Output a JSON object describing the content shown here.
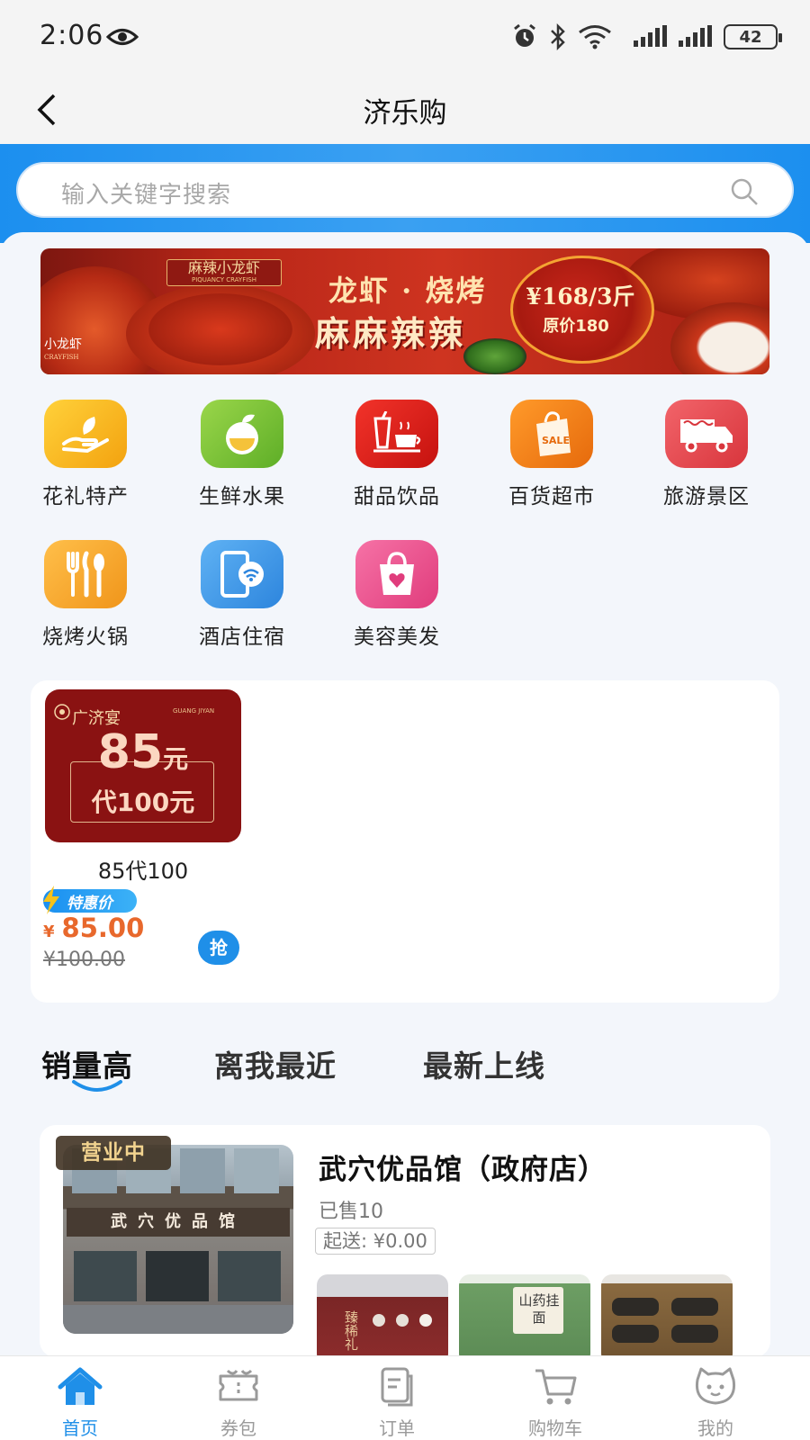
{
  "status_bar": {
    "time": "2:06",
    "battery": "42"
  },
  "nav": {
    "title": "济乐购"
  },
  "search": {
    "placeholder": "输入关键字搜索"
  },
  "banner": {
    "brand": "麻辣小龙虾",
    "brand_en": "PIQUANCY CRAYFISH",
    "line1": "龙虾 · 烧烤",
    "line2": "麻麻辣辣",
    "price": "¥168/3斤",
    "original_price": "原价180",
    "corner_tag": "小龙虾",
    "corner_tag_en": "CRAYFISH"
  },
  "categories": [
    {
      "label": "花礼特产",
      "icon": "gift-hand-icon",
      "color": "#f6b21a"
    },
    {
      "label": "生鲜水果",
      "icon": "fruit-icon",
      "color": "#7cc63a"
    },
    {
      "label": "甜品饮品",
      "icon": "dessert-drink-icon",
      "color": "#e8281f"
    },
    {
      "label": "百货超市",
      "icon": "shopping-bag-sale-icon",
      "color": "#f07a14"
    },
    {
      "label": "旅游景区",
      "icon": "truck-icon",
      "color": "#ea4b52"
    },
    {
      "label": "烧烤火锅",
      "icon": "utensils-icon",
      "color": "#f5a623"
    },
    {
      "label": "酒店住宿",
      "icon": "phone-wifi-icon",
      "color": "#3a9ae8"
    },
    {
      "label": "美容美发",
      "icon": "heart-bag-icon",
      "color": "#ec4c8c"
    }
  ],
  "coupon": {
    "logo": "广济宴",
    "logo_en": "GUANG JIYAN",
    "amount": "85",
    "amount_unit": "元",
    "subtitle": "代100元",
    "name": "85代100",
    "badge": "特惠价",
    "currency": "¥",
    "price": "85.00",
    "original_price": "¥100.00",
    "grab_label": "抢"
  },
  "sort_tabs": [
    {
      "label": "销量高",
      "active": true
    },
    {
      "label": "离我最近",
      "active": false
    },
    {
      "label": "最新上线",
      "active": false
    }
  ],
  "shop": {
    "status": "营业中",
    "sign": "武穴优品馆",
    "name": "武穴优品馆（政府店）",
    "sold": "已售10",
    "min_order": "起送: ¥0.00",
    "thumb2_text": "山药挂面",
    "thumb1_text": "臻稀礼"
  },
  "tabbar": [
    {
      "label": "首页",
      "icon": "home-icon",
      "active": true
    },
    {
      "label": "券包",
      "icon": "coupon-icon",
      "active": false
    },
    {
      "label": "订单",
      "icon": "order-icon",
      "active": false
    },
    {
      "label": "购物车",
      "icon": "cart-icon",
      "active": false
    },
    {
      "label": "我的",
      "icon": "profile-icon",
      "active": false
    }
  ],
  "colors": {
    "accent": "#1f8fe8",
    "price": "#e8682c"
  }
}
